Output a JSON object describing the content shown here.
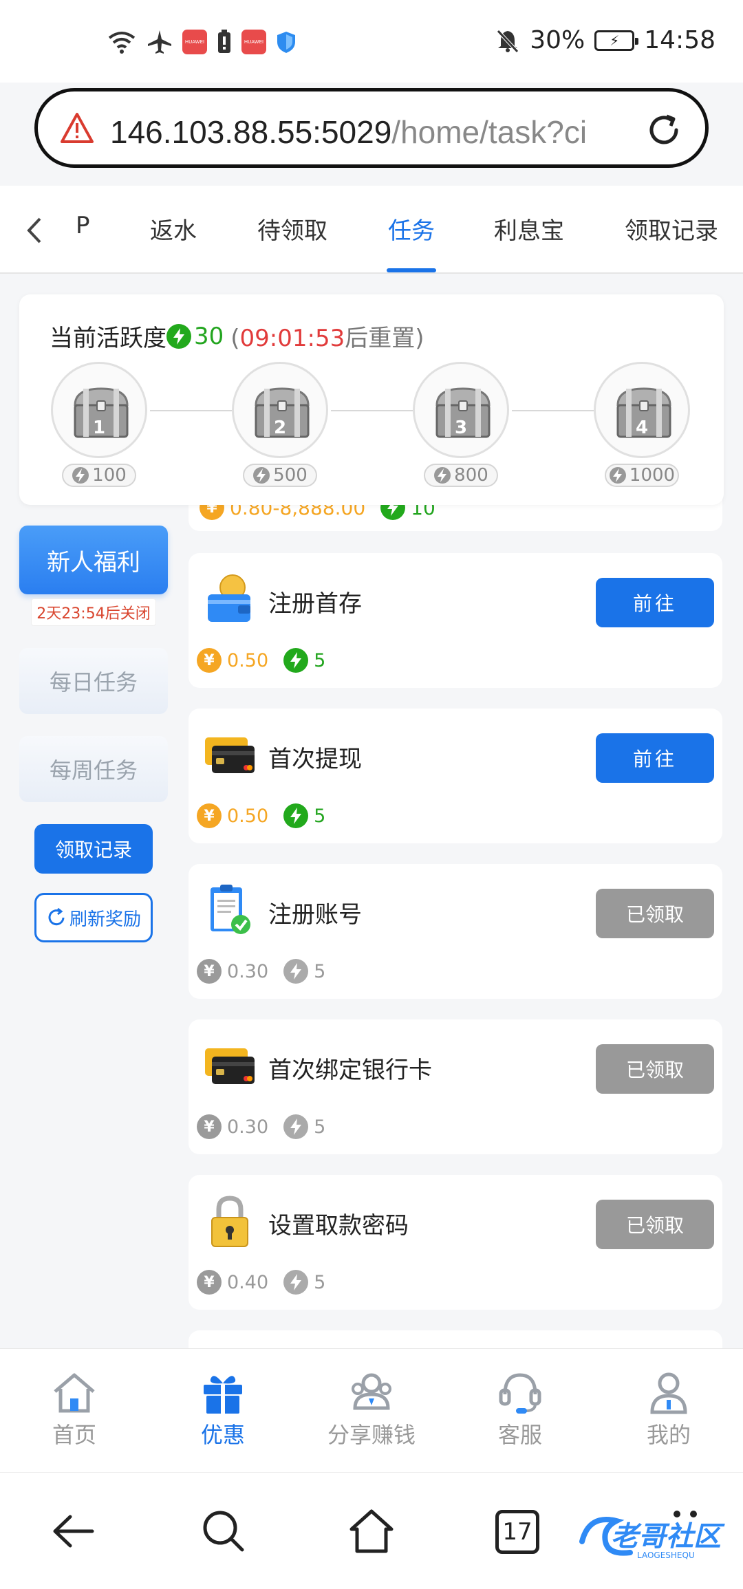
{
  "status_bar": {
    "notification_icons": [
      "wifi-icon",
      "airplane-icon",
      "huawei-app-icon",
      "battery-saver-icon",
      "huawei-app-icon",
      "shield-icon"
    ],
    "battery_percent": "30%",
    "time": "14:58"
  },
  "browser": {
    "url_host": "146.103.88.55:5029",
    "url_path": "/home/task?ci"
  },
  "tabs": {
    "items": [
      {
        "label": "P"
      },
      {
        "label": "返水"
      },
      {
        "label": "待领取"
      },
      {
        "label": "任务"
      },
      {
        "label": "利息宝"
      },
      {
        "label": "领取记录"
      }
    ],
    "active_index": 3
  },
  "activity": {
    "title": "当前活跃度",
    "points": "30",
    "reset_open": "(",
    "reset_time": "09:01:53",
    "reset_suffix": "后重置)",
    "chests": [
      {
        "number": "1",
        "requirement": "100"
      },
      {
        "number": "2",
        "requirement": "500"
      },
      {
        "number": "3",
        "requirement": "800"
      },
      {
        "number": "4",
        "requirement": "1000"
      }
    ]
  },
  "sidebar": {
    "newbie_label": "新人福利",
    "countdown": "2天23:54后关闭",
    "daily_label": "每日任务",
    "weekly_label": "每周任务",
    "record_label": "领取记录",
    "refresh_label": "刷新奖励"
  },
  "partial_task": {
    "amount": "0.80-8,888.00",
    "points": "10"
  },
  "tasks": [
    {
      "title": "注册首存",
      "icon": "wallet-coin-icon",
      "amount": "0.50",
      "points": "5",
      "button": "前往",
      "state": "go"
    },
    {
      "title": "首次提现",
      "icon": "bank-card-icon",
      "amount": "0.50",
      "points": "5",
      "button": "前往",
      "state": "go"
    },
    {
      "title": "注册账号",
      "icon": "clipboard-check-icon",
      "amount": "0.30",
      "points": "5",
      "button": "已领取",
      "state": "done"
    },
    {
      "title": "首次绑定银行卡",
      "icon": "bank-card-icon",
      "amount": "0.30",
      "points": "5",
      "button": "已领取",
      "state": "done"
    },
    {
      "title": "设置取款密码",
      "icon": "padlock-icon",
      "amount": "0.40",
      "points": "5",
      "button": "已领取",
      "state": "done"
    }
  ],
  "bottom_nav": {
    "items": [
      {
        "label": "首页",
        "icon": "home-icon"
      },
      {
        "label": "优惠",
        "icon": "gift-icon"
      },
      {
        "label": "分享赚钱",
        "icon": "share-users-icon"
      },
      {
        "label": "客服",
        "icon": "headset-icon"
      },
      {
        "label": "我的",
        "icon": "user-icon"
      }
    ],
    "active_index": 1
  },
  "system_nav": {
    "tab_count": "17"
  },
  "colors": {
    "accent": "#1a73e8",
    "green": "#22a91c",
    "gold": "#f5a623",
    "red": "#e13b3b",
    "disabled": "#999999"
  }
}
